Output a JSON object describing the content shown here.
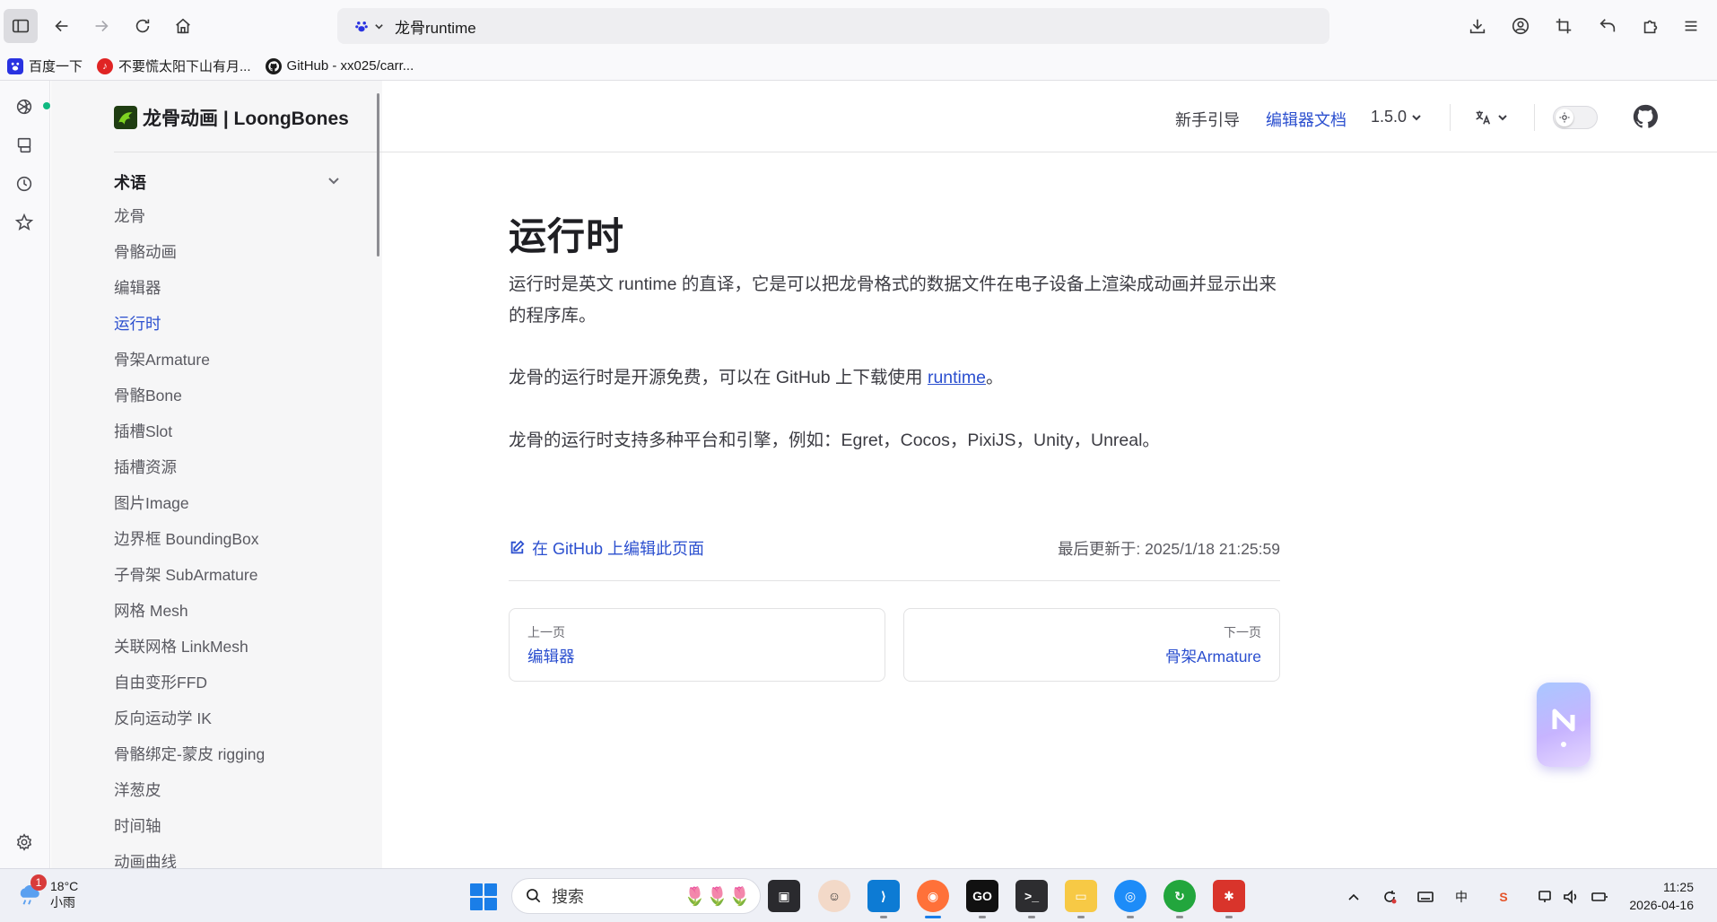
{
  "browser": {
    "url_text": "龙骨runtime",
    "bookmarks": [
      {
        "label": "百度一下",
        "icon": "baidu-icon",
        "color": "#2932e1"
      },
      {
        "label": "不要慌太阳下山有月...",
        "icon": "netease-music-icon",
        "color": "#e02424"
      },
      {
        "label": "GitHub - xx025/carr...",
        "icon": "github-icon",
        "color": "#1b1b1b"
      }
    ]
  },
  "site": {
    "brand": "龙骨动画 | LoongBones",
    "nav": {
      "guide": "新手引导",
      "editor_docs": "编辑器文档",
      "version": "1.5.0"
    }
  },
  "sidebar": {
    "section_title": "术语",
    "items": [
      {
        "label": "龙骨"
      },
      {
        "label": "骨骼动画"
      },
      {
        "label": "编辑器"
      },
      {
        "label": "运行时",
        "active": true
      },
      {
        "label": "骨架Armature"
      },
      {
        "label": "骨骼Bone"
      },
      {
        "label": "插槽Slot"
      },
      {
        "label": "插槽资源"
      },
      {
        "label": "图片Image"
      },
      {
        "label": "边界框 BoundingBox"
      },
      {
        "label": "子骨架 SubArmature"
      },
      {
        "label": "网格 Mesh"
      },
      {
        "label": "关联网格 LinkMesh"
      },
      {
        "label": "自由变形FFD"
      },
      {
        "label": "反向运动学 IK"
      },
      {
        "label": "骨骼绑定-蒙皮 rigging"
      },
      {
        "label": "洋葱皮"
      },
      {
        "label": "时间轴"
      },
      {
        "label": "动画曲线"
      }
    ]
  },
  "content": {
    "title": "运行时",
    "para1": "运行时是英文 runtime 的直译，它是可以把龙骨格式的数据文件在电子设备上渲染成动画并显示出来的程序库。",
    "para2_prefix": "龙骨的运行时是开源免费，可以在 GitHub 上下载使用 ",
    "para2_link": "runtime",
    "para2_suffix": "。",
    "para3": "龙骨的运行时支持多种平台和引擎，例如：Egret，Cocos，PixiJS，Unity，Unreal。",
    "edit_link": "在 GitHub 上编辑此页面",
    "last_updated": "最后更新于: 2025/1/18 21:25:59",
    "prev": {
      "desc": "上一页",
      "title": "编辑器"
    },
    "next": {
      "desc": "下一页",
      "title": "骨架Armature"
    }
  },
  "taskbar": {
    "weather_temp": "18°C",
    "weather_desc": "小雨",
    "weather_badge": "1",
    "search_placeholder": "搜索",
    "ime": "中",
    "time": "11:25",
    "date": "2026-04-16"
  },
  "colors": {
    "accent": "#2b4fcf",
    "windows_blue": "#1a7ee8"
  }
}
